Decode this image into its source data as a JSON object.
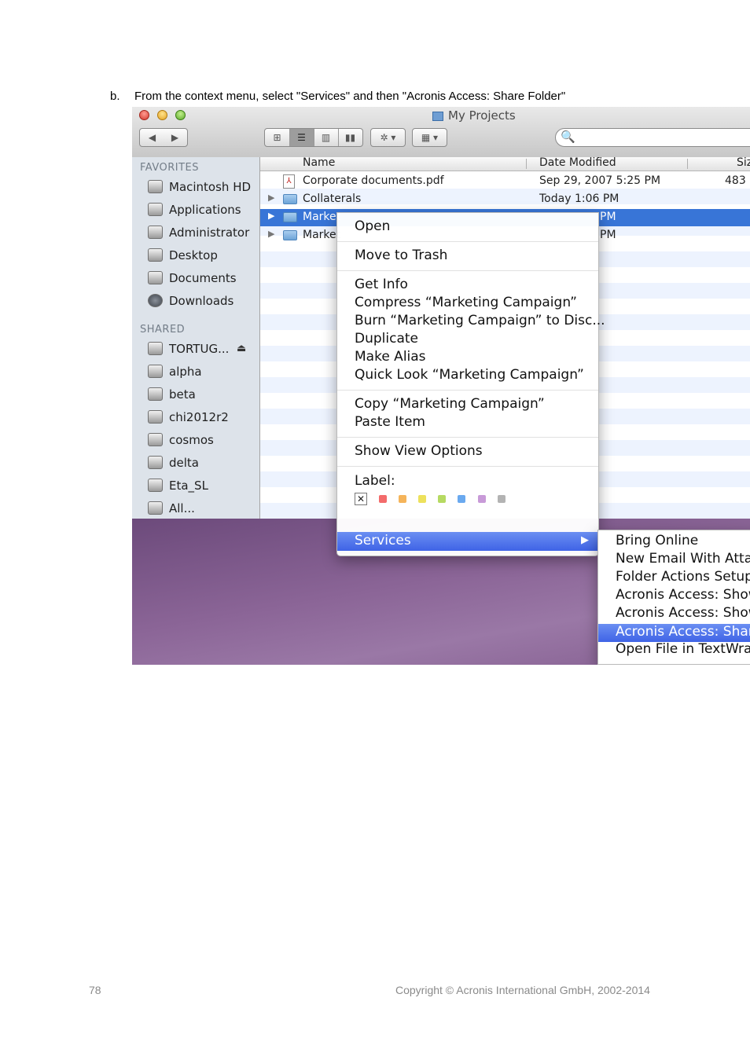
{
  "instruction": {
    "marker": "b.",
    "text": "From the context menu, select \"Services\" and then \"Acronis Access: Share Folder\""
  },
  "window": {
    "title": "My Projects",
    "toolbar": {
      "back": "◀",
      "forward": "▶",
      "view_icons": "⊞",
      "view_list": "☰",
      "view_columns": "▥",
      "view_coverflow": "▮▮",
      "action": "✲ ▾",
      "arrange": "▦ ▾",
      "search_glyph": "🔍"
    },
    "sidebar": {
      "favorites_heading": "FAVORITES",
      "favorites": [
        "Macintosh HD",
        "Applications",
        "Administrator",
        "Desktop",
        "Documents",
        "Downloads"
      ],
      "shared_heading": "SHARED",
      "shared": [
        "TORTUG...",
        "alpha",
        "beta",
        "chi2012r2",
        "cosmos",
        "delta",
        "Eta_SL",
        "All..."
      ],
      "eject_glyph": "⏏"
    },
    "columns": {
      "name": "Name",
      "date": "Date Modified",
      "size": "Siz"
    },
    "rows": [
      {
        "name": "Corporate documents.pdf",
        "date": "Sep 29, 2007 5:25 PM",
        "size": "483 I"
      },
      {
        "name": "Collaterals",
        "date": "Today 1:06 PM",
        "size": ""
      },
      {
        "name": "Market",
        "date": "PM",
        "size": ""
      },
      {
        "name": "Market",
        "date": "PM",
        "size": ""
      }
    ],
    "pdf_glyph": "⅄",
    "disclosure_glyph": "▶"
  },
  "context_menu": {
    "open": "Open",
    "move_to_trash": "Move to Trash",
    "get_info": "Get Info",
    "compress": "Compress “Marketing Campaign”",
    "burn": "Burn “Marketing Campaign” to Disc...",
    "duplicate": "Duplicate",
    "make_alias": "Make Alias",
    "quick_look": "Quick Look “Marketing Campaign”",
    "copy": "Copy “Marketing Campaign”",
    "paste": "Paste Item",
    "show_view_options": "Show View Options",
    "label_heading": "Label:",
    "label_none": "✕",
    "label_colors": [
      "#f36b6b",
      "#f5b45a",
      "#ede15c",
      "#b6da62",
      "#6aa9ef",
      "#c89ad8",
      "#b3b3b3"
    ],
    "services": "Services",
    "services_arrow": "▶"
  },
  "services_submenu": {
    "items": [
      "Bring Online",
      "New Email With Attach",
      "Folder Actions Setup...",
      "Acronis Access: Show",
      "Acronis Access: Show",
      "Acronis Access: Share",
      "Open File in TextWran"
    ],
    "selected_index": 5
  },
  "footer": {
    "page_number": "78",
    "copyright": "Copyright © Acronis International GmbH, 2002-2014"
  }
}
